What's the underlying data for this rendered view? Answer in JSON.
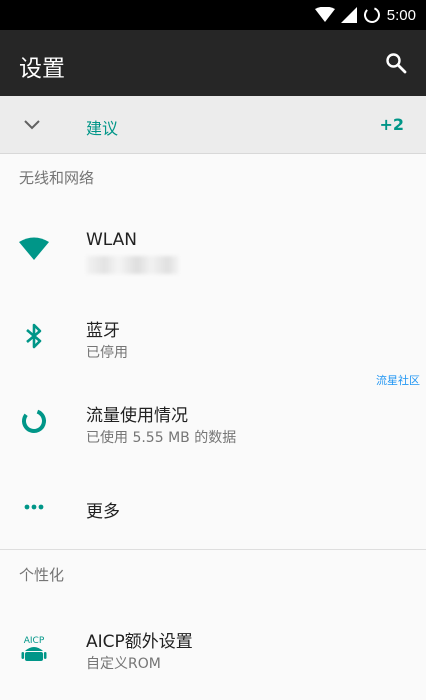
{
  "status_bar": {
    "time": "5:00"
  },
  "toolbar": {
    "title": "设置"
  },
  "suggestions": {
    "label": "建议",
    "count": "+2"
  },
  "sections": [
    {
      "header": "无线和网络",
      "items": [
        {
          "title": "WLAN",
          "subtitle": ""
        },
        {
          "title": "蓝牙",
          "subtitle": "已停用"
        },
        {
          "title": "流量使用情况",
          "subtitle": "已使用 5.55 MB 的数据"
        },
        {
          "title": "更多"
        }
      ]
    },
    {
      "header": "个性化",
      "items": [
        {
          "title": "AICP额外设置",
          "subtitle": "自定义ROM"
        }
      ]
    }
  ],
  "watermark": "流星社区",
  "colors": {
    "accent": "#009688",
    "toolbar": "#262626",
    "status_bar": "#000000"
  }
}
